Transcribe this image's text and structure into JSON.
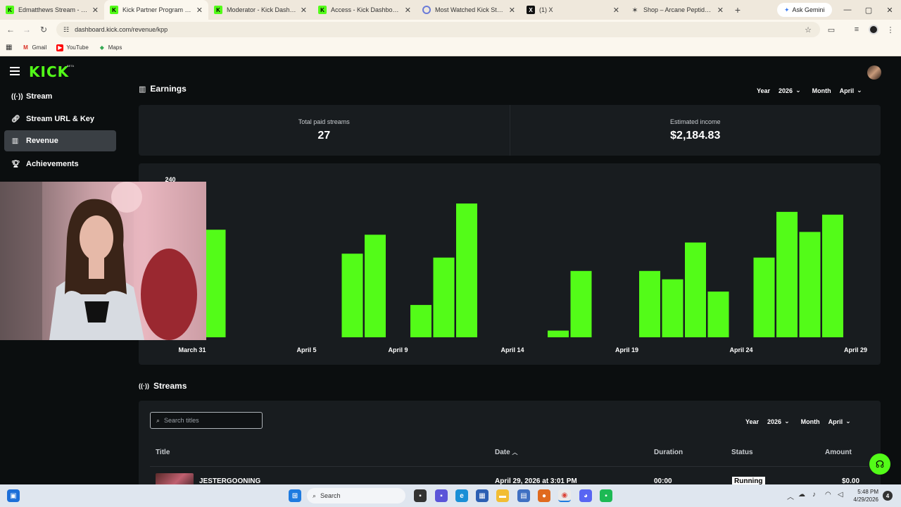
{
  "browser": {
    "tabs": [
      {
        "label": "Edmatthews Stream - Watch",
        "favicon": "kick-icon",
        "active": false
      },
      {
        "label": "Kick Partner Program - Kick",
        "favicon": "kick-icon",
        "active": true
      },
      {
        "label": "Moderator - Kick Dashboard",
        "favicon": "kick-icon",
        "active": false
      },
      {
        "label": "Access - Kick Dashboard",
        "favicon": "kick-icon",
        "active": false
      },
      {
        "label": "Most Watched Kick Streame",
        "favicon": "loading-icon",
        "active": false
      },
      {
        "label": "(1) X",
        "favicon": "x-icon",
        "active": false
      },
      {
        "label": "Shop – Arcane Peptides | Pr",
        "favicon": "arcane-icon",
        "active": false
      }
    ],
    "new_tab": "+",
    "gemini_label": "Ask Gemini",
    "url": "dashboard.kick.com/revenue/kpp",
    "bookmarks": [
      {
        "label": "Gmail",
        "icon": "gmail-icon"
      },
      {
        "label": "YouTube",
        "icon": "youtube-icon"
      },
      {
        "label": "Maps",
        "icon": "maps-icon"
      }
    ]
  },
  "app": {
    "logo": "KICK",
    "beta": "BETA",
    "accent": "#53fc18",
    "sidebar": [
      {
        "label": "Stream",
        "icon": "broadcast-icon",
        "active": false
      },
      {
        "label": "Stream URL & Key",
        "icon": "link-icon",
        "active": false
      },
      {
        "label": "Revenue",
        "icon": "bar-chart-icon",
        "active": true
      },
      {
        "label": "Achievements",
        "icon": "trophy-icon",
        "active": false
      }
    ]
  },
  "earnings": {
    "title": "Earnings",
    "year_label": "Year",
    "year_value": "2026",
    "month_label": "Month",
    "month_value": "April",
    "stats": [
      {
        "label": "Total paid streams",
        "value": "27"
      },
      {
        "label": "Estimated income",
        "value": "$2,184.83"
      }
    ]
  },
  "chart_data": {
    "type": "bar",
    "ymax_label": "240",
    "ylim": [
      0,
      240
    ],
    "x_tick_labels": [
      "March 31",
      "April 5",
      "April 9",
      "April 14",
      "April 19",
      "April 24",
      "April 29"
    ],
    "bar_color": "#53fc18",
    "categories": [
      "March 31",
      "April 1",
      "April 2",
      "April 3",
      "April 4",
      "April 5",
      "April 6",
      "April 7",
      "April 8",
      "April 9",
      "April 10",
      "April 11",
      "April 12",
      "April 13",
      "April 14",
      "April 15",
      "April 16",
      "April 17",
      "April 18",
      "April 19",
      "April 20",
      "April 21",
      "April 22",
      "April 23",
      "April 24",
      "April 25",
      "April 26",
      "April 27",
      "April 28",
      "April 29"
    ],
    "values": [
      150,
      193,
      0,
      0,
      0,
      0,
      0,
      150,
      184,
      0,
      58,
      143,
      240,
      0,
      0,
      0,
      12,
      119,
      0,
      0,
      119,
      104,
      170,
      82,
      0,
      143,
      225,
      189,
      220,
      0
    ]
  },
  "streams": {
    "title": "Streams",
    "search_placeholder": "Search titles",
    "year_label": "Year",
    "year_value": "2026",
    "month_label": "Month",
    "month_value": "April",
    "columns": {
      "title": "Title",
      "date": "Date",
      "duration": "Duration",
      "status": "Status",
      "amount": "Amount"
    },
    "rows": [
      {
        "title": "JESTERGOONING",
        "date": "April 29, 2026 at 3:01 PM",
        "duration": "00:00",
        "status": "Running",
        "amount": "$0.00"
      }
    ]
  },
  "taskbar": {
    "search_label": "Search",
    "time": "5:48 PM",
    "date": "4/29/2026",
    "notification_count": "4"
  }
}
